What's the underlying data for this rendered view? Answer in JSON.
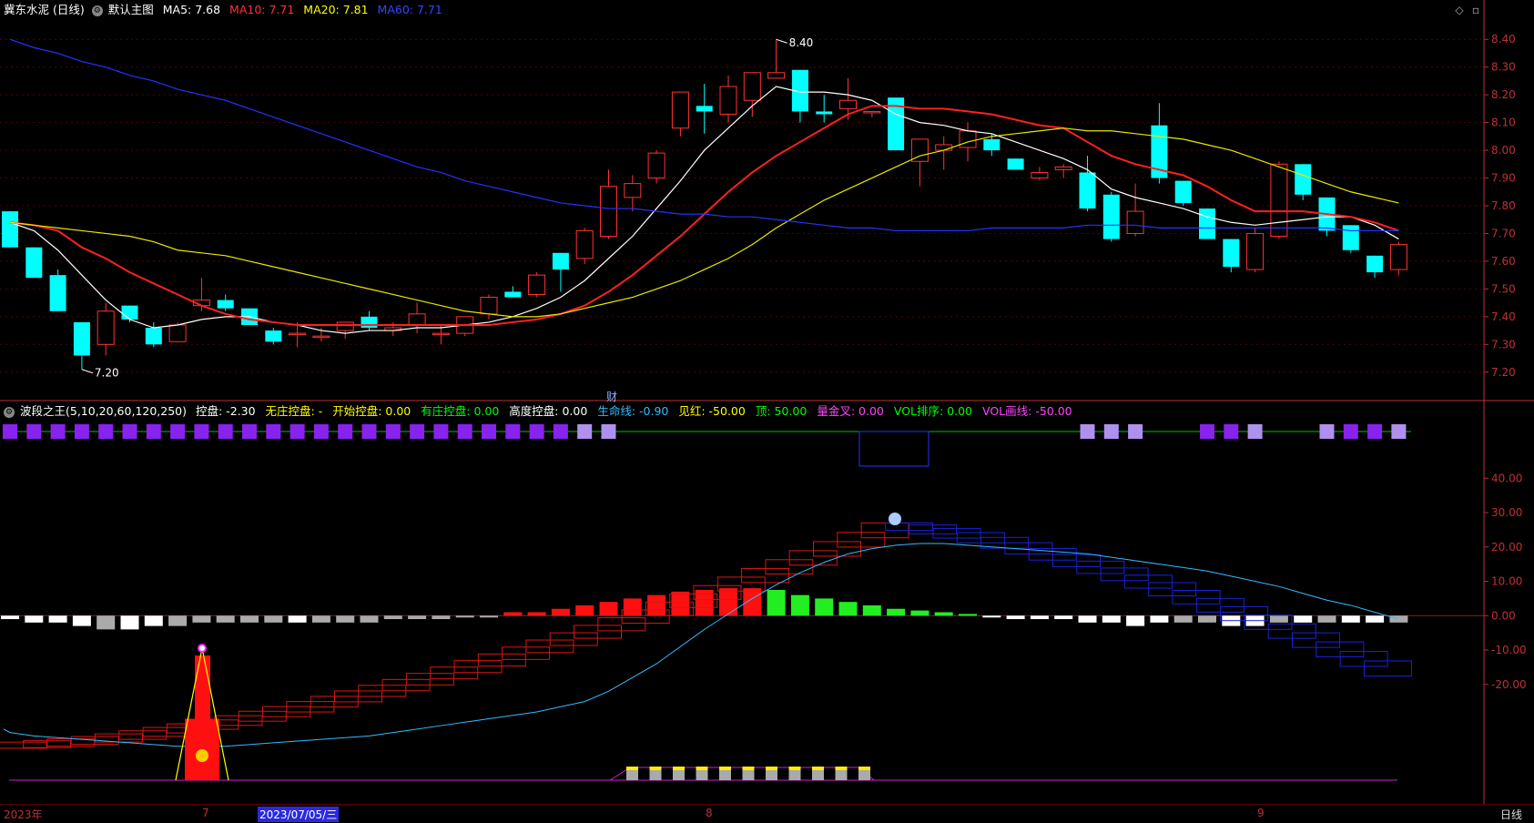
{
  "header": {
    "stock_name": "冀东水泥 (日线)",
    "template": "默认主图",
    "ma5": "MA5: 7.68",
    "ma10": "MA10: 7.71",
    "ma20": "MA20: 7.81",
    "ma60": "MA60: 7.71"
  },
  "indicator_header": {
    "name": "波段之王(5,10,20,60,120,250)",
    "items": [
      {
        "text": "控盘: -2.30",
        "color": "#ffffff"
      },
      {
        "text": "无庄控盘: -",
        "color": "#ffff00"
      },
      {
        "text": "开始控盘: 0.00",
        "color": "#ffff00"
      },
      {
        "text": "有庄控盘: 0.00",
        "color": "#00ff00"
      },
      {
        "text": "高度控盘: 0.00",
        "color": "#ffffff"
      },
      {
        "text": "生命线: -0.90",
        "color": "#33bbff"
      },
      {
        "text": "见红: -50.00",
        "color": "#ffff00"
      },
      {
        "text": "顶: 50.00",
        "color": "#00ff00"
      },
      {
        "text": "量金叉: 0.00",
        "color": "#ff44ff"
      },
      {
        "text": "VOL排序: 0.00",
        "color": "#00ff00"
      },
      {
        "text": "VOL画线: -50.00",
        "color": "#ff44ff"
      }
    ]
  },
  "colors": {
    "up": "#ff3333",
    "down": "#00ffff",
    "ma5": "#ffffff",
    "ma10": "#ff2020",
    "ma20": "#e8e800",
    "ma60": "#2233ff",
    "axis": "#c03030"
  },
  "chart_data": [
    {
      "type": "candlestick",
      "title": "冀东水泥 (日线)",
      "ylim": [
        7.15,
        8.45
      ],
      "y_ticks": [
        "8.40",
        "8.30",
        "8.20",
        "8.10",
        "8.00",
        "7.90",
        "7.80",
        "7.70",
        "7.60",
        "7.50",
        "7.40",
        "7.30",
        "7.20"
      ],
      "annotations": [
        {
          "text": "8.40",
          "kind": "high"
        },
        {
          "text": "7.20",
          "kind": "low"
        },
        {
          "text": "财",
          "kind": "marker"
        }
      ],
      "candles": [
        [
          7.78,
          7.78,
          7.65,
          7.65
        ],
        [
          7.65,
          7.65,
          7.54,
          7.54
        ],
        [
          7.55,
          7.57,
          7.42,
          7.42
        ],
        [
          7.38,
          7.38,
          7.21,
          7.26
        ],
        [
          7.3,
          7.45,
          7.26,
          7.42
        ],
        [
          7.44,
          7.44,
          7.38,
          7.39
        ],
        [
          7.36,
          7.38,
          7.29,
          7.3
        ],
        [
          7.31,
          7.38,
          7.31,
          7.37
        ],
        [
          7.44,
          7.54,
          7.42,
          7.46
        ],
        [
          7.46,
          7.48,
          7.42,
          7.43
        ],
        [
          7.43,
          7.43,
          7.37,
          7.37
        ],
        [
          7.35,
          7.36,
          7.3,
          7.31
        ],
        [
          7.34,
          7.38,
          7.29,
          7.34
        ],
        [
          7.33,
          7.36,
          7.31,
          7.33
        ],
        [
          7.35,
          7.38,
          7.32,
          7.38
        ],
        [
          7.4,
          7.42,
          7.35,
          7.36
        ],
        [
          7.35,
          7.38,
          7.33,
          7.36
        ],
        [
          7.37,
          7.45,
          7.34,
          7.41
        ],
        [
          7.34,
          7.37,
          7.3,
          7.34
        ],
        [
          7.34,
          7.4,
          7.33,
          7.4
        ],
        [
          7.41,
          7.48,
          7.39,
          7.47
        ],
        [
          7.49,
          7.51,
          7.47,
          7.47
        ],
        [
          7.48,
          7.56,
          7.47,
          7.55
        ],
        [
          7.63,
          7.63,
          7.49,
          7.57
        ],
        [
          7.61,
          7.72,
          7.59,
          7.71
        ],
        [
          7.69,
          7.93,
          7.68,
          7.87
        ],
        [
          7.83,
          7.91,
          7.78,
          7.88
        ],
        [
          7.9,
          8.0,
          7.88,
          7.99
        ],
        [
          8.08,
          8.21,
          8.05,
          8.21
        ],
        [
          8.16,
          8.24,
          8.06,
          8.14
        ],
        [
          8.13,
          8.27,
          8.1,
          8.23
        ],
        [
          8.18,
          8.28,
          8.12,
          8.28
        ],
        [
          8.26,
          8.4,
          8.26,
          8.28
        ],
        [
          8.29,
          8.29,
          8.1,
          8.14
        ],
        [
          8.14,
          8.2,
          8.1,
          8.13
        ],
        [
          8.15,
          8.26,
          8.11,
          8.18
        ],
        [
          8.14,
          8.14,
          8.12,
          8.14
        ],
        [
          8.19,
          8.19,
          8.0,
          8.0
        ],
        [
          7.96,
          8.04,
          7.87,
          8.04
        ],
        [
          8.0,
          8.05,
          7.93,
          8.02
        ],
        [
          8.01,
          8.1,
          7.96,
          8.07
        ],
        [
          8.04,
          8.06,
          7.98,
          8.0
        ],
        [
          7.97,
          7.97,
          7.93,
          7.93
        ],
        [
          7.9,
          7.94,
          7.89,
          7.92
        ],
        [
          7.93,
          7.95,
          7.9,
          7.94
        ],
        [
          7.92,
          7.98,
          7.78,
          7.79
        ],
        [
          7.84,
          7.85,
          7.67,
          7.68
        ],
        [
          7.7,
          7.88,
          7.69,
          7.78
        ],
        [
          8.09,
          8.17,
          7.88,
          7.9
        ],
        [
          7.89,
          7.89,
          7.8,
          7.81
        ],
        [
          7.79,
          7.79,
          7.68,
          7.68
        ],
        [
          7.68,
          7.68,
          7.56,
          7.58
        ],
        [
          7.57,
          7.72,
          7.56,
          7.7
        ],
        [
          7.69,
          7.96,
          7.68,
          7.95
        ],
        [
          7.95,
          7.95,
          7.82,
          7.84
        ],
        [
          7.83,
          7.83,
          7.69,
          7.71
        ],
        [
          7.73,
          7.73,
          7.63,
          7.64
        ],
        [
          7.62,
          7.62,
          7.54,
          7.56
        ],
        [
          7.57,
          7.67,
          7.55,
          7.66
        ]
      ]
    },
    {
      "type": "line",
      "title": "MA",
      "series": [
        {
          "name": "MA5",
          "color": "#ffffff",
          "values": [
            7.74,
            7.71,
            7.64,
            7.55,
            7.46,
            7.39,
            7.36,
            7.37,
            7.39,
            7.4,
            7.4,
            7.38,
            7.37,
            7.35,
            7.34,
            7.35,
            7.35,
            7.36,
            7.36,
            7.37,
            7.38,
            7.4,
            7.43,
            7.47,
            7.53,
            7.61,
            7.69,
            7.79,
            7.89,
            8.0,
            8.08,
            8.16,
            8.23,
            8.21,
            8.21,
            8.2,
            8.18,
            8.13,
            8.1,
            8.09,
            8.07,
            8.06,
            8.03,
            8.0,
            7.97,
            7.93,
            7.86,
            7.83,
            7.81,
            7.79,
            7.76,
            7.74,
            7.73,
            7.74,
            7.75,
            7.76,
            7.76,
            7.73,
            7.68
          ]
        },
        {
          "name": "MA10",
          "color": "#ff2020",
          "values": [
            7.74,
            7.73,
            7.71,
            7.65,
            7.61,
            7.56,
            7.52,
            7.48,
            7.44,
            7.41,
            7.39,
            7.38,
            7.37,
            7.37,
            7.37,
            7.37,
            7.37,
            7.37,
            7.37,
            7.37,
            7.37,
            7.38,
            7.39,
            7.41,
            7.44,
            7.49,
            7.55,
            7.62,
            7.69,
            7.77,
            7.85,
            7.92,
            7.98,
            8.03,
            8.08,
            8.13,
            8.16,
            8.16,
            8.15,
            8.15,
            8.14,
            8.13,
            8.11,
            8.09,
            8.08,
            8.03,
            7.98,
            7.95,
            7.93,
            7.91,
            7.87,
            7.82,
            7.78,
            7.78,
            7.78,
            7.77,
            7.76,
            7.74,
            7.71
          ]
        },
        {
          "name": "MA20",
          "color": "#e8e800",
          "values": [
            7.74,
            7.73,
            7.72,
            7.71,
            7.7,
            7.69,
            7.67,
            7.64,
            7.63,
            7.62,
            7.6,
            7.58,
            7.56,
            7.54,
            7.52,
            7.5,
            7.48,
            7.46,
            7.44,
            7.42,
            7.41,
            7.4,
            7.4,
            7.41,
            7.43,
            7.45,
            7.47,
            7.5,
            7.53,
            7.57,
            7.61,
            7.66,
            7.72,
            7.77,
            7.82,
            7.86,
            7.9,
            7.94,
            7.98,
            8.0,
            8.03,
            8.05,
            8.06,
            8.07,
            8.08,
            8.07,
            8.07,
            8.06,
            8.05,
            8.04,
            8.02,
            8.0,
            7.97,
            7.94,
            7.91,
            7.88,
            7.85,
            7.83,
            7.81
          ]
        },
        {
          "name": "MA60",
          "color": "#2233ff",
          "values": [
            8.4,
            8.37,
            8.35,
            8.32,
            8.3,
            8.27,
            8.25,
            8.22,
            8.2,
            8.18,
            8.15,
            8.12,
            8.09,
            8.06,
            8.03,
            8.0,
            7.97,
            7.94,
            7.92,
            7.89,
            7.87,
            7.85,
            7.83,
            7.81,
            7.8,
            7.79,
            7.79,
            7.78,
            7.77,
            7.77,
            7.76,
            7.76,
            7.75,
            7.74,
            7.73,
            7.72,
            7.72,
            7.71,
            7.71,
            7.71,
            7.71,
            7.72,
            7.72,
            7.72,
            7.72,
            7.73,
            7.73,
            7.73,
            7.72,
            7.72,
            7.72,
            7.72,
            7.72,
            7.72,
            7.72,
            7.72,
            7.71,
            7.71,
            7.71
          ]
        }
      ]
    },
    {
      "type": "bar",
      "title": "波段之王",
      "ylim": [
        -50,
        52
      ],
      "y_ticks": [
        "40.00",
        "30.00",
        "20.00",
        "10.00",
        "0.00",
        "-10.00",
        "-20.00"
      ],
      "histogram": [
        -1,
        -2,
        -2,
        -3,
        -4,
        -4,
        -3,
        -3,
        -2,
        -2,
        -2,
        -2,
        -2,
        -2,
        -2,
        -2,
        -1,
        -1,
        -1,
        0,
        -0.5,
        1,
        1,
        2,
        3,
        4,
        5,
        6,
        7,
        7.5,
        8,
        8,
        7.5,
        6,
        5,
        4,
        3,
        2,
        1.5,
        1,
        0.5,
        -0.5,
        -1,
        -1,
        -1,
        -2,
        -2,
        -3,
        -2,
        -2,
        -2,
        -3,
        -3,
        -2,
        -2,
        -2,
        -2,
        -2,
        -2
      ],
      "histogram_colors": [
        "w",
        "w",
        "w",
        "w",
        "g",
        "w",
        "w",
        "g",
        "g",
        "g",
        "g",
        "g",
        "w",
        "g",
        "g",
        "g",
        "g",
        "g",
        "g",
        "g",
        "g",
        "r",
        "r",
        "r",
        "r",
        "r",
        "r",
        "r",
        "r",
        "r",
        "r",
        "r",
        "G",
        "G",
        "G",
        "G",
        "G",
        "G",
        "G",
        "G",
        "G",
        "w",
        "w",
        "w",
        "w",
        "w",
        "w",
        "w",
        "w",
        "g",
        "g",
        "w",
        "w",
        "g",
        "w",
        "g",
        "w",
        "w",
        "g"
      ],
      "purple_markers_top": [
        1,
        1,
        1,
        1,
        1,
        1,
        1,
        1,
        1,
        1,
        1,
        1,
        1,
        1,
        1,
        1,
        1,
        1,
        1,
        1,
        1,
        1,
        1,
        1,
        2,
        2,
        0,
        0,
        0,
        0,
        0,
        0,
        0,
        0,
        0,
        0,
        0,
        0,
        0,
        0,
        0,
        0,
        0,
        0,
        0,
        2,
        2,
        2,
        0,
        0,
        1,
        1,
        2,
        0,
        0,
        2,
        1,
        1,
        2
      ],
      "life_line": [
        -34,
        -35,
        -35.5,
        -36,
        -36.5,
        -37,
        -37.5,
        -38,
        -38,
        -38,
        -37.5,
        -37,
        -36.5,
        -36,
        -35.5,
        -35,
        -34,
        -33,
        -32,
        -31,
        -30,
        -29,
        -28,
        -26.5,
        -25,
        -22,
        -18,
        -14,
        -9,
        -4,
        0.5,
        5,
        9,
        12.5,
        15.5,
        18,
        19.5,
        20.5,
        21,
        21,
        20.5,
        20,
        19.5,
        19,
        18.5,
        18,
        17,
        16,
        15,
        14,
        13,
        11.5,
        10,
        8.5,
        6.5,
        4.5,
        3,
        1,
        -1
      ]
    }
  ],
  "dates": {
    "year": "2023年",
    "m7": "7",
    "selected": "2023/07/05/三",
    "m8": "8",
    "m9": "9"
  },
  "footer": {
    "period": "日线"
  }
}
